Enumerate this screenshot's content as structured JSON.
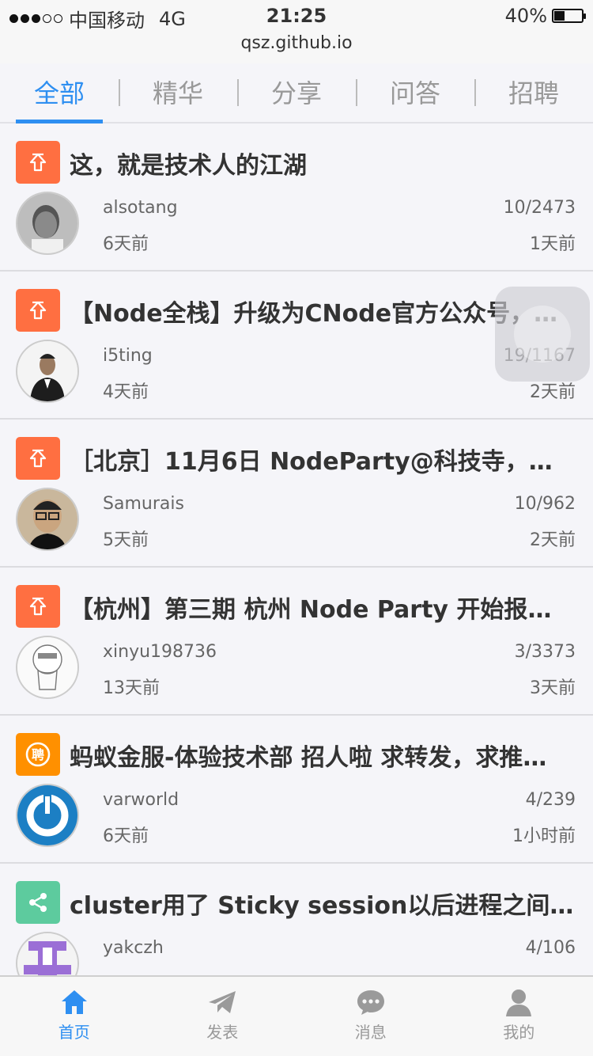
{
  "status_bar": {
    "carrier": "中国移动",
    "network": "4G",
    "time": "21:25",
    "battery": "40%",
    "battery_level": 0.4,
    "signal_bars": 3,
    "url": "qsz.github.io"
  },
  "tabs": [
    {
      "label": "全部",
      "active": true
    },
    {
      "label": "精华",
      "active": false
    },
    {
      "label": "分享",
      "active": false
    },
    {
      "label": "问答",
      "active": false
    },
    {
      "label": "招聘",
      "active": false
    }
  ],
  "topics": [
    {
      "badge": "pin-icon",
      "badge_color": "#ff6f41",
      "title": "这，就是技术人的江湖",
      "author": "alsotang",
      "created": "6天前",
      "counts": "10/2473",
      "last_reply": "1天前"
    },
    {
      "badge": "pin-icon",
      "badge_color": "#ff6f41",
      "title": "【Node全栈】升级为CNode官方公众号，…",
      "author": "i5ting",
      "created": "4天前",
      "counts": "19/1167",
      "last_reply": "2天前"
    },
    {
      "badge": "pin-icon",
      "badge_color": "#ff6f41",
      "title": "［北京］11月6日 NodeParty@科技寺，…",
      "author": "Samurais",
      "created": "5天前",
      "counts": "10/962",
      "last_reply": "2天前"
    },
    {
      "badge": "pin-icon",
      "badge_color": "#ff6f41",
      "title": "【杭州】第三期 杭州 Node Party 开始报名…",
      "author": "xinyu198736",
      "created": "13天前",
      "counts": "3/3373",
      "last_reply": "3天前"
    },
    {
      "badge": "job-icon",
      "badge_color": "#ff9000",
      "title": "蚂蚁金服-体验技术部 招人啦 求转发，求推…",
      "author": "varworld",
      "created": "6天前",
      "counts": "4/239",
      "last_reply": "1小时前"
    },
    {
      "badge": "share-icon",
      "badge_color": "#5dcb9e",
      "title": "cluster用了 Sticky session以后进程之间…",
      "author": "yakczh",
      "created": "",
      "counts": "4/106",
      "last_reply": ""
    }
  ],
  "tab_bar": [
    {
      "label": "首页",
      "icon": "home-icon",
      "active": true
    },
    {
      "label": "发表",
      "icon": "send-icon",
      "active": false
    },
    {
      "label": "消息",
      "icon": "message-icon",
      "active": false
    },
    {
      "label": "我的",
      "icon": "user-icon",
      "active": false
    }
  ]
}
